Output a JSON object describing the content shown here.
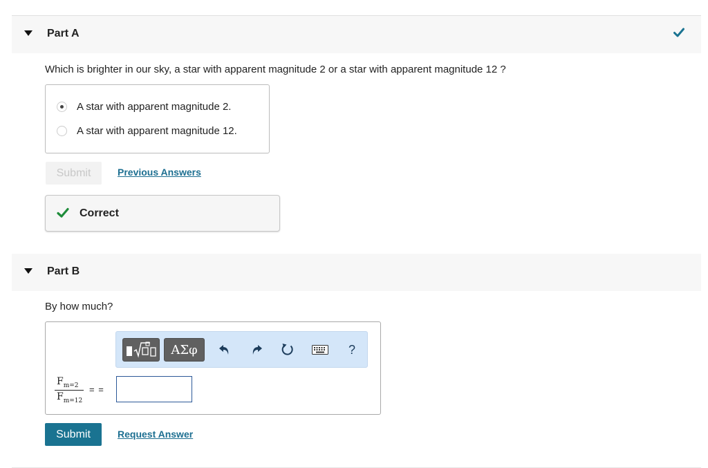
{
  "partA": {
    "title": "Part A",
    "question": "Which is brighter in our sky, a star with apparent magnitude 2 or a star with apparent magnitude 12 ?",
    "choices": [
      {
        "label": "A star with apparent magnitude 2.",
        "selected": true
      },
      {
        "label": "A star with apparent magnitude 12.",
        "selected": false
      }
    ],
    "submit_label": "Submit",
    "previous_answers_label": "Previous Answers",
    "feedback_label": "Correct",
    "status_icon": "check-icon"
  },
  "partB": {
    "title": "Part B",
    "question": "By how much?",
    "toolbar": {
      "templates_icon": "templates-icon",
      "symbols_label": "ΑΣφ",
      "undo_icon": "undo-icon",
      "redo_icon": "redo-icon",
      "reset_icon": "reset-icon",
      "keyboard_icon": "keyboard-icon",
      "help_label": "?"
    },
    "fraction": {
      "num_base": "F",
      "num_sub": "m=2",
      "den_base": "F",
      "den_sub": "m=12"
    },
    "equals": "= =",
    "answer_value": "",
    "submit_label": "Submit",
    "request_answer_label": "Request Answer"
  },
  "colors": {
    "accent": "#1a7391",
    "link": "#1d6f91",
    "correct": "#1e8c3a",
    "toolbar_bg": "#d4e6f9"
  }
}
